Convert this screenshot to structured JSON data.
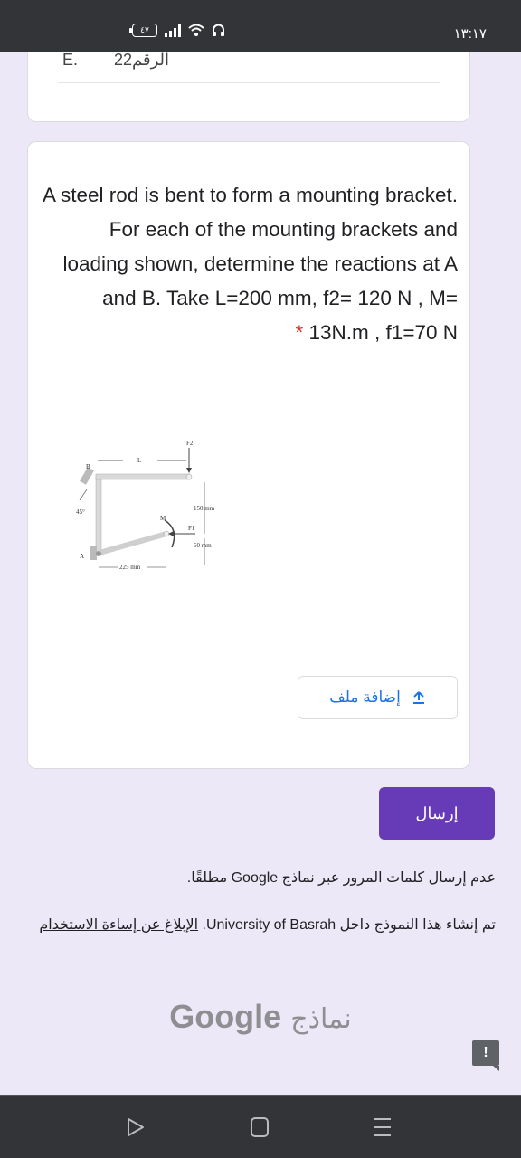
{
  "status_bar": {
    "time": "١٣:١٧",
    "battery": "٤٧",
    "icons": [
      "battery-icon",
      "signal-icon",
      "wifi-icon",
      "headphones-icon"
    ]
  },
  "previous_card": {
    "partial_label": "الرقم22",
    "partial_left": "E."
  },
  "question": {
    "text": "A steel rod is bent to form a mounting bracket. For each of the mounting brackets and loading shown, determine the reactions at A and B. Take L=200 mm, f2= 120 N , M=",
    "text_end": "13N.m , f1=70 N",
    "required_marker": "*",
    "figure": {
      "labels": {
        "f2": "F2",
        "L": "L",
        "B": "B",
        "angle": "45°",
        "dim_150": "150 mm",
        "M": "M",
        "f1": "F1",
        "dim_50": "50 mm",
        "A": "A",
        "dim_225": "225 mm"
      }
    },
    "upload_button": "إضافة ملف"
  },
  "form": {
    "submit_label": "إرسال",
    "password_note": "عدم إرسال كلمات المرور عبر نماذج Google مطلقًا.",
    "created_in": "تم إنشاء هذا النموذج داخل University of Basrah.",
    "report_link": "الإبلاغ عن إساءة الاستخدام",
    "brand_ar": "نماذج",
    "brand_en": "Google"
  },
  "colors": {
    "accent": "#673ab7",
    "link": "#1a73e8",
    "background": "#ede8f7",
    "bars": "#333438"
  }
}
